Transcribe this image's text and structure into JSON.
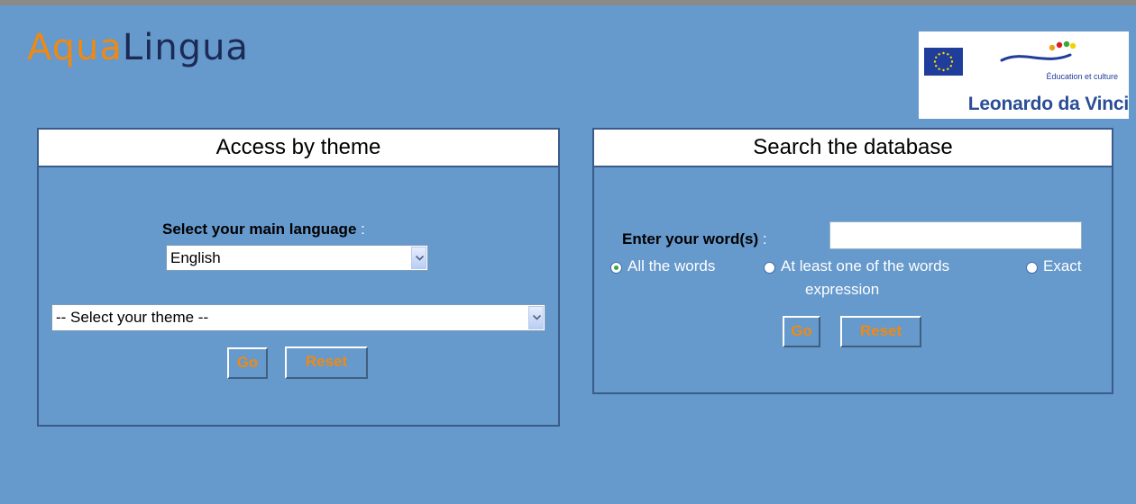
{
  "header": {
    "logo_part1": "Aqua",
    "logo_part2": "Lingua",
    "eu_culture": "Éducation et culture",
    "eu_programme": "Leonardo da Vinci"
  },
  "theme_panel": {
    "title": "Access by theme",
    "language_label": "Select your main language",
    "colon": ":",
    "language_value": "English",
    "theme_value": "-- Select your theme --",
    "go_label": "Go",
    "reset_label": "Reset"
  },
  "search_panel": {
    "title": "Search the database",
    "words_label": "Enter your word(s)",
    "colon": ":",
    "words_value": "",
    "options": [
      {
        "label": "All the words",
        "checked": true
      },
      {
        "label": "At least one of the words",
        "checked": false
      },
      {
        "label": "Exact",
        "checked": false
      }
    ],
    "option3_continued": "expression",
    "go_label": "Go",
    "reset_label": "Reset"
  },
  "colors": {
    "background": "#6699cc",
    "accent": "#ee8a14",
    "panel_border": "#3a5c8a"
  }
}
